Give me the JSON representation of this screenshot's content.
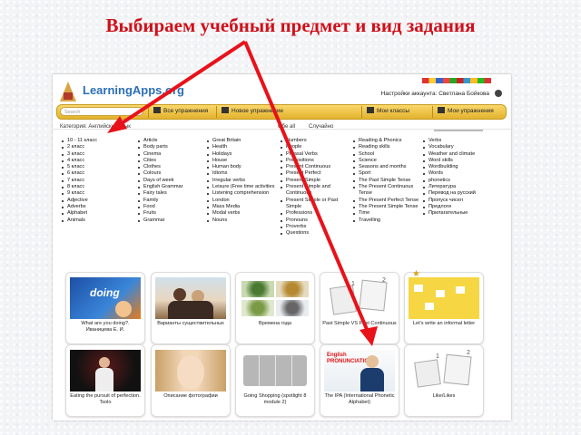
{
  "slide": {
    "title": "Выбираем учебный предмет и вид задания"
  },
  "site": {
    "logo": "LearningApps.org",
    "account": "Настройки аккаунта: Светлана Бойкова",
    "search_placeholder": "Search",
    "nav": [
      "Все упражнения",
      "Новое упражнение",
      "Мои классы",
      "Мои упражнения"
    ]
  },
  "filters": {
    "category": "Категория: Английский язык",
    "level": "Обе all",
    "sort": "Случайно"
  },
  "categories": [
    [
      "10 - 11 класс",
      "2 класс",
      "3 класс",
      "4 класс",
      "5 класс",
      "6 класс",
      "7 класс",
      "8 класс",
      "9 класс",
      "Adjective",
      "Adverbs",
      "Alphabet",
      "Animals"
    ],
    [
      "Article",
      "Body parts",
      "Cinema",
      "Cities",
      "Clothes",
      "Colours",
      "Days of week",
      "English Grammar",
      "Fairy tales",
      "Family",
      "Food",
      "Fruits",
      "Grammar"
    ],
    [
      "Great Britain",
      "Health",
      "Holidays",
      "House",
      "Human body",
      "Idioms",
      "Irregular verbs",
      "Leisure (Free time activities",
      "Listening comprehension",
      "London",
      "Mass Media",
      "Modal verbs",
      "Nouns"
    ],
    [
      "Numbers",
      "People",
      "Phrasal Verbs",
      "Prepositions",
      "Present Continuous",
      "Present Perfect",
      "Present Simple",
      "Present Simple and Continuous",
      "Present Simple or Past Simple",
      "Professions",
      "Pronouns",
      "Proverbs",
      "Questions"
    ],
    [
      "Reading & Phonics",
      "Reading skills",
      "School",
      "Science",
      "Seasons and months",
      "Sport",
      "The Past Simple Tense",
      "The Present Continuous Tense",
      "The Present Perfect Tense",
      "The Present Simple Tense",
      "Time",
      "Travelling"
    ],
    [
      "Verbs",
      "Vocabulary",
      "Weather and climate",
      "Word skills",
      "Wordbuilding",
      "Words",
      "phonetics",
      "Литература",
      "Перевод на русский",
      "Пропуск чисел",
      "Предлоги",
      "Прилагательные"
    ]
  ],
  "cards": [
    {
      "caption": "What are you doing?. Иваницева Е. И."
    },
    {
      "caption": "Варианты существительных"
    },
    {
      "caption": "Времена года"
    },
    {
      "caption": "Past Simple VS Past Continuous"
    },
    {
      "caption": "Let's write an informal letter"
    },
    {
      "caption": "Eating the pursuit of perfection. Tsolo"
    },
    {
      "caption": "Описание фотографии"
    },
    {
      "caption": "Going Shopping (spotlight 8 module 2)"
    },
    {
      "caption": "The IPA (International Phonetic Alphabet)"
    },
    {
      "caption": "Like/Likes"
    }
  ],
  "thumb_texts": {
    "card1": "doing",
    "card9": "English PRONUNCIATION",
    "nums": [
      "1",
      "2"
    ]
  },
  "colors": {
    "title": "#d0101a",
    "arrow": "#e8121a",
    "navbar": "#f1c74a"
  }
}
